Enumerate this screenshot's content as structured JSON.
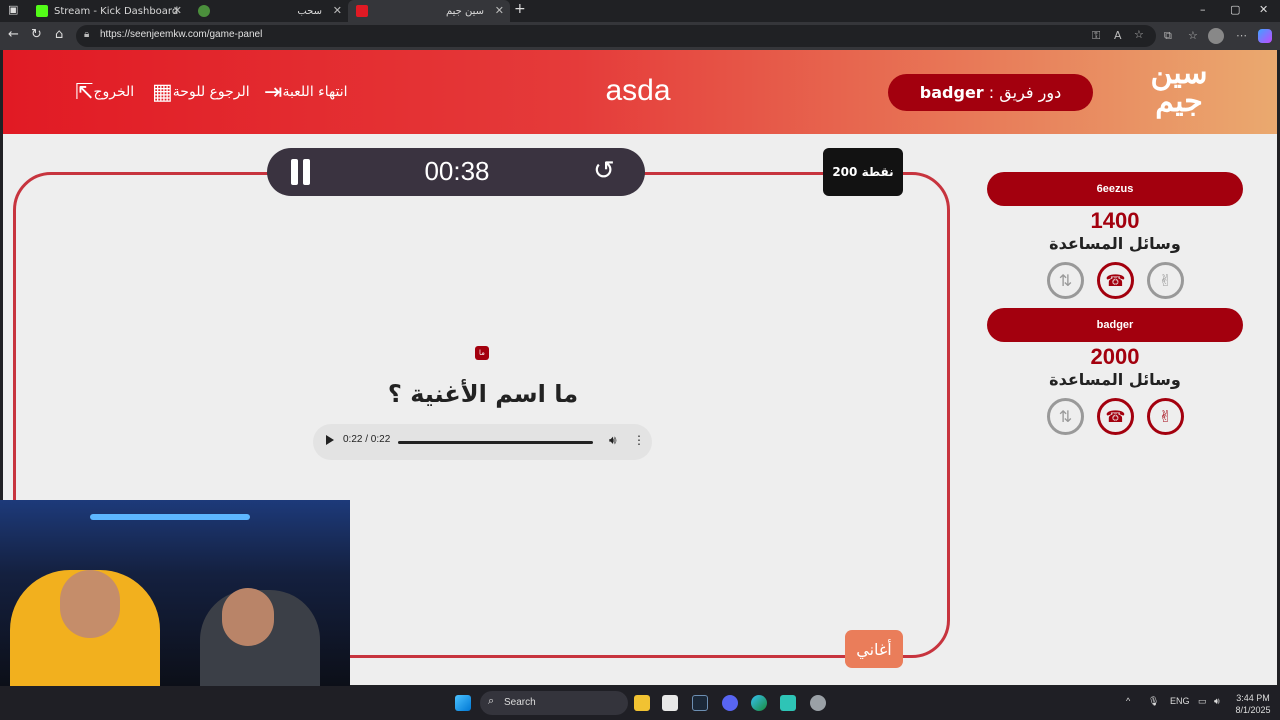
{
  "browser": {
    "tabs": [
      {
        "title": "Stream - Kick Dashboard",
        "active": false
      },
      {
        "title": "سحب",
        "active": false
      },
      {
        "title": "سين جيم",
        "active": true
      }
    ],
    "url": "https://seenjeemkw.com/game-panel",
    "window_controls": [
      "–",
      "▢",
      "✕"
    ]
  },
  "header": {
    "logo_text": "سين جيم",
    "turn_label": "دور فريق :",
    "turn_team": "badger",
    "game_title": "asda",
    "end_game": "انتهاء اللعبة",
    "back_to_board": "الرجوع للوحة",
    "exit": "الخروج"
  },
  "board": {
    "timer": "00:38",
    "points": "200 نقطة",
    "question_badge": "ما",
    "question": "ما اسم الأغنية ؟",
    "audio_time": "0:22 / 0:22",
    "audio_progress": 1.0,
    "category": "أغاني"
  },
  "teams": [
    {
      "name": "6eezus",
      "score": "1400",
      "aids_label": "وسائل المساعدة"
    },
    {
      "name": "badger",
      "score": "2000",
      "aids_label": "وسائل المساعدة"
    }
  ],
  "taskbar": {
    "search_label": "Search",
    "lang": "ENG",
    "time": "3:44 PM",
    "date": "8/1/2025"
  },
  "colors": {
    "brand_red": "#a3000e",
    "header_start": "#e11a24",
    "header_end": "#eaa96f",
    "board_border": "#c7343e",
    "category_orange": "#ea7d5a"
  }
}
